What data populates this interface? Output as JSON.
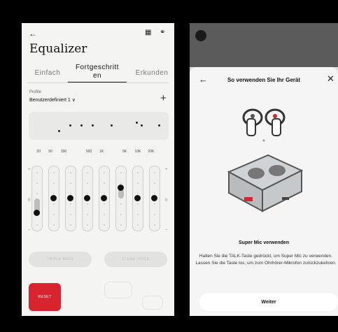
{
  "equalizer": {
    "back_icon": "arrow-left-icon",
    "title": "Equalizer",
    "tabs": [
      "Einfach",
      "Fortgeschritt\nen",
      "Erkunden"
    ],
    "active_tab": 1,
    "profile_label": "Profile",
    "profile_value": "Benutzerdefiniert 1 ∨",
    "add_label": "+",
    "frequencies": [
      "20",
      "50",
      "100",
      "500",
      "1K",
      "5K",
      "10K",
      "20K"
    ],
    "slider_levels": [
      -0.6,
      0,
      0,
      0,
      0,
      0.4,
      0,
      0
    ],
    "reset_label": "RESET",
    "preset_left": "TRIPLE BASS",
    "preset_right": "CLEAR VOICE"
  },
  "sheet": {
    "back_icon": "arrow-left-icon",
    "title": "So verwenden Sie Ihr Gerät",
    "close_label": "✕",
    "mic_title": "Super Mic verwenden",
    "mic_description": "Halten Sie die TALK-Taste gedrückt, um Super Mic zu verwenden. Lassen Sie die Taste los, um zum Ohrhörer-Mikrofon zurückzukehren.",
    "continue_label": "Weiter"
  },
  "colors": {
    "accent": "#d7242f",
    "knob": "#111111"
  }
}
